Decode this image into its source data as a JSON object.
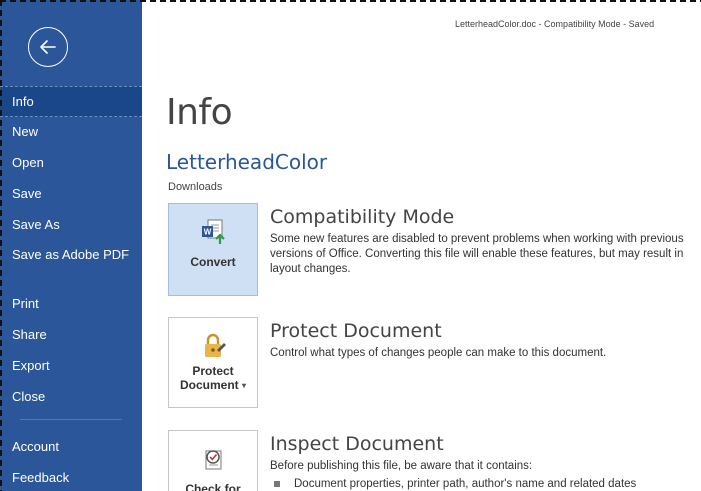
{
  "window": {
    "title": "LetterheadColor.doc  -  Compatibility Mode  -  Saved"
  },
  "sidebar": {
    "back_icon": "back-arrow-icon",
    "items": [
      {
        "label": "Info",
        "active": true
      },
      {
        "label": "New"
      },
      {
        "label": "Open"
      },
      {
        "label": "Save"
      },
      {
        "label": "Save As"
      },
      {
        "label": "Save as Adobe PDF"
      },
      {
        "label": "Print"
      },
      {
        "label": "Share"
      },
      {
        "label": "Export"
      },
      {
        "label": "Close"
      },
      {
        "label": "Account"
      },
      {
        "label": "Feedback"
      }
    ],
    "color": "#2b579a",
    "active_color": "#19478a"
  },
  "main": {
    "title": "Info",
    "doc_name": "LetterheadColor",
    "doc_location": "Downloads",
    "sections": [
      {
        "button": "Convert",
        "icon": "word-convert-icon",
        "heading": "Compatibility Mode",
        "text": "Some new features are disabled to prevent problems when working with previous versions of Office. Converting this file will enable these features, but may result in layout changes."
      },
      {
        "button": "Protect Document",
        "button_line1": "Protect",
        "button_line2": "Document",
        "icon": "lock-icon",
        "heading": "Protect Document",
        "text": "Control what types of changes people can make to this document."
      },
      {
        "button": "Check for Issues",
        "button_line1": "Check for",
        "icon": "inspect-document-icon",
        "heading": "Inspect Document",
        "text": "Before publishing this file, be aware that it contains:",
        "bullets": [
          "Document properties, printer path, author's name and related dates"
        ]
      }
    ]
  }
}
